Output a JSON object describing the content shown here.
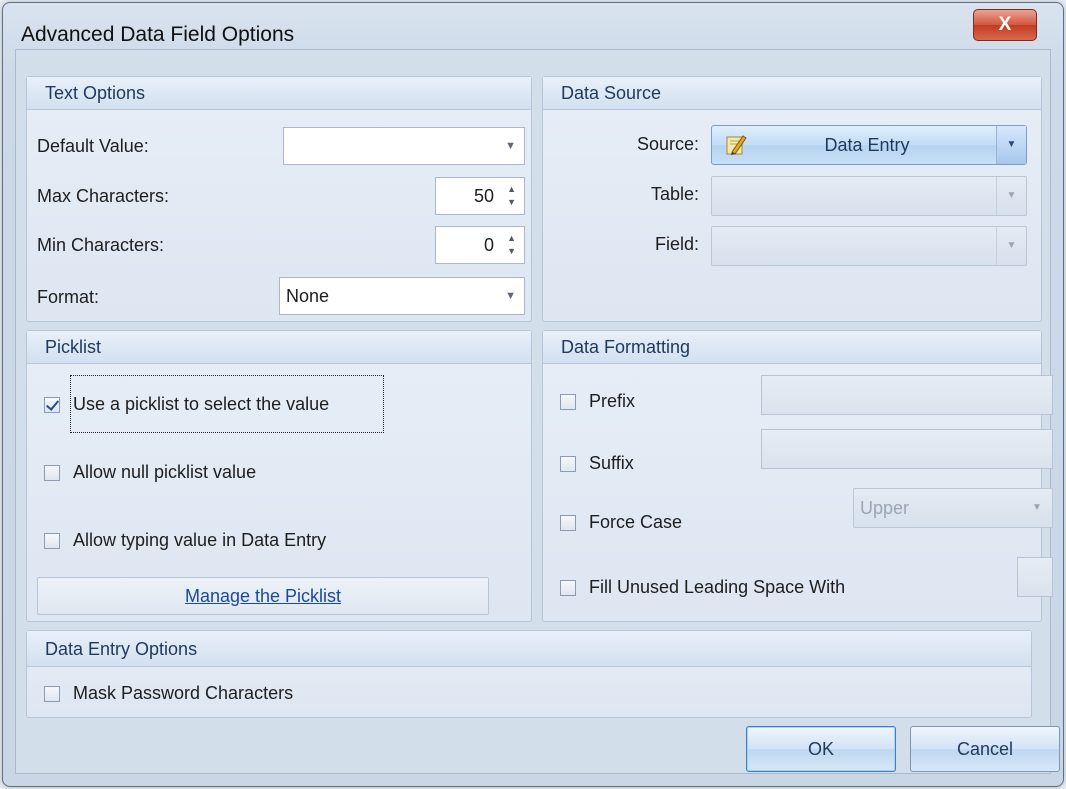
{
  "window": {
    "title": "Advanced Data Field Options",
    "close_glyph": "X"
  },
  "text_options": {
    "header": "Text Options",
    "default_value_label": "Default Value:",
    "default_value": "",
    "max_chars_label": "Max Characters:",
    "max_chars": "50",
    "min_chars_label": "Min Characters:",
    "min_chars": "0",
    "format_label": "Format:",
    "format_value": "None"
  },
  "data_source": {
    "header": "Data Source",
    "source_label": "Source:",
    "source_value": "Data Entry",
    "table_label": "Table:",
    "table_value": "",
    "field_label": "Field:",
    "field_value": ""
  },
  "picklist": {
    "header": "Picklist",
    "use_picklist_label": "Use a picklist to select the value",
    "use_picklist_checked": true,
    "allow_null_label": "Allow null picklist value",
    "allow_null_checked": false,
    "allow_typing_label": "Allow typing value in Data Entry",
    "allow_typing_checked": false,
    "manage_label": "Manage the Picklist"
  },
  "data_formatting": {
    "header": "Data Formatting",
    "prefix_label": "Prefix",
    "prefix_checked": false,
    "prefix_value": "",
    "suffix_label": "Suffix",
    "suffix_checked": false,
    "suffix_value": "",
    "force_case_label": "Force Case",
    "force_case_checked": false,
    "force_case_value": "Upper",
    "fill_label": "Fill Unused Leading Space With",
    "fill_checked": false,
    "fill_value": ""
  },
  "data_entry_options": {
    "header": "Data Entry Options",
    "mask_label": "Mask Password Characters",
    "mask_checked": false
  },
  "buttons": {
    "ok": "OK",
    "cancel": "Cancel"
  },
  "icons": {
    "close": "close-icon",
    "source": "pencil-icon",
    "dropdown": "chevron-down-icon",
    "spin_up": "chevron-up-icon",
    "spin_down": "chevron-down-icon",
    "check": "checkmark-icon"
  },
  "colors": {
    "window_bg": "#d3deeb",
    "group_header_text": "#1e395b",
    "link": "#1a49a0",
    "close_button": "#c23b22"
  }
}
